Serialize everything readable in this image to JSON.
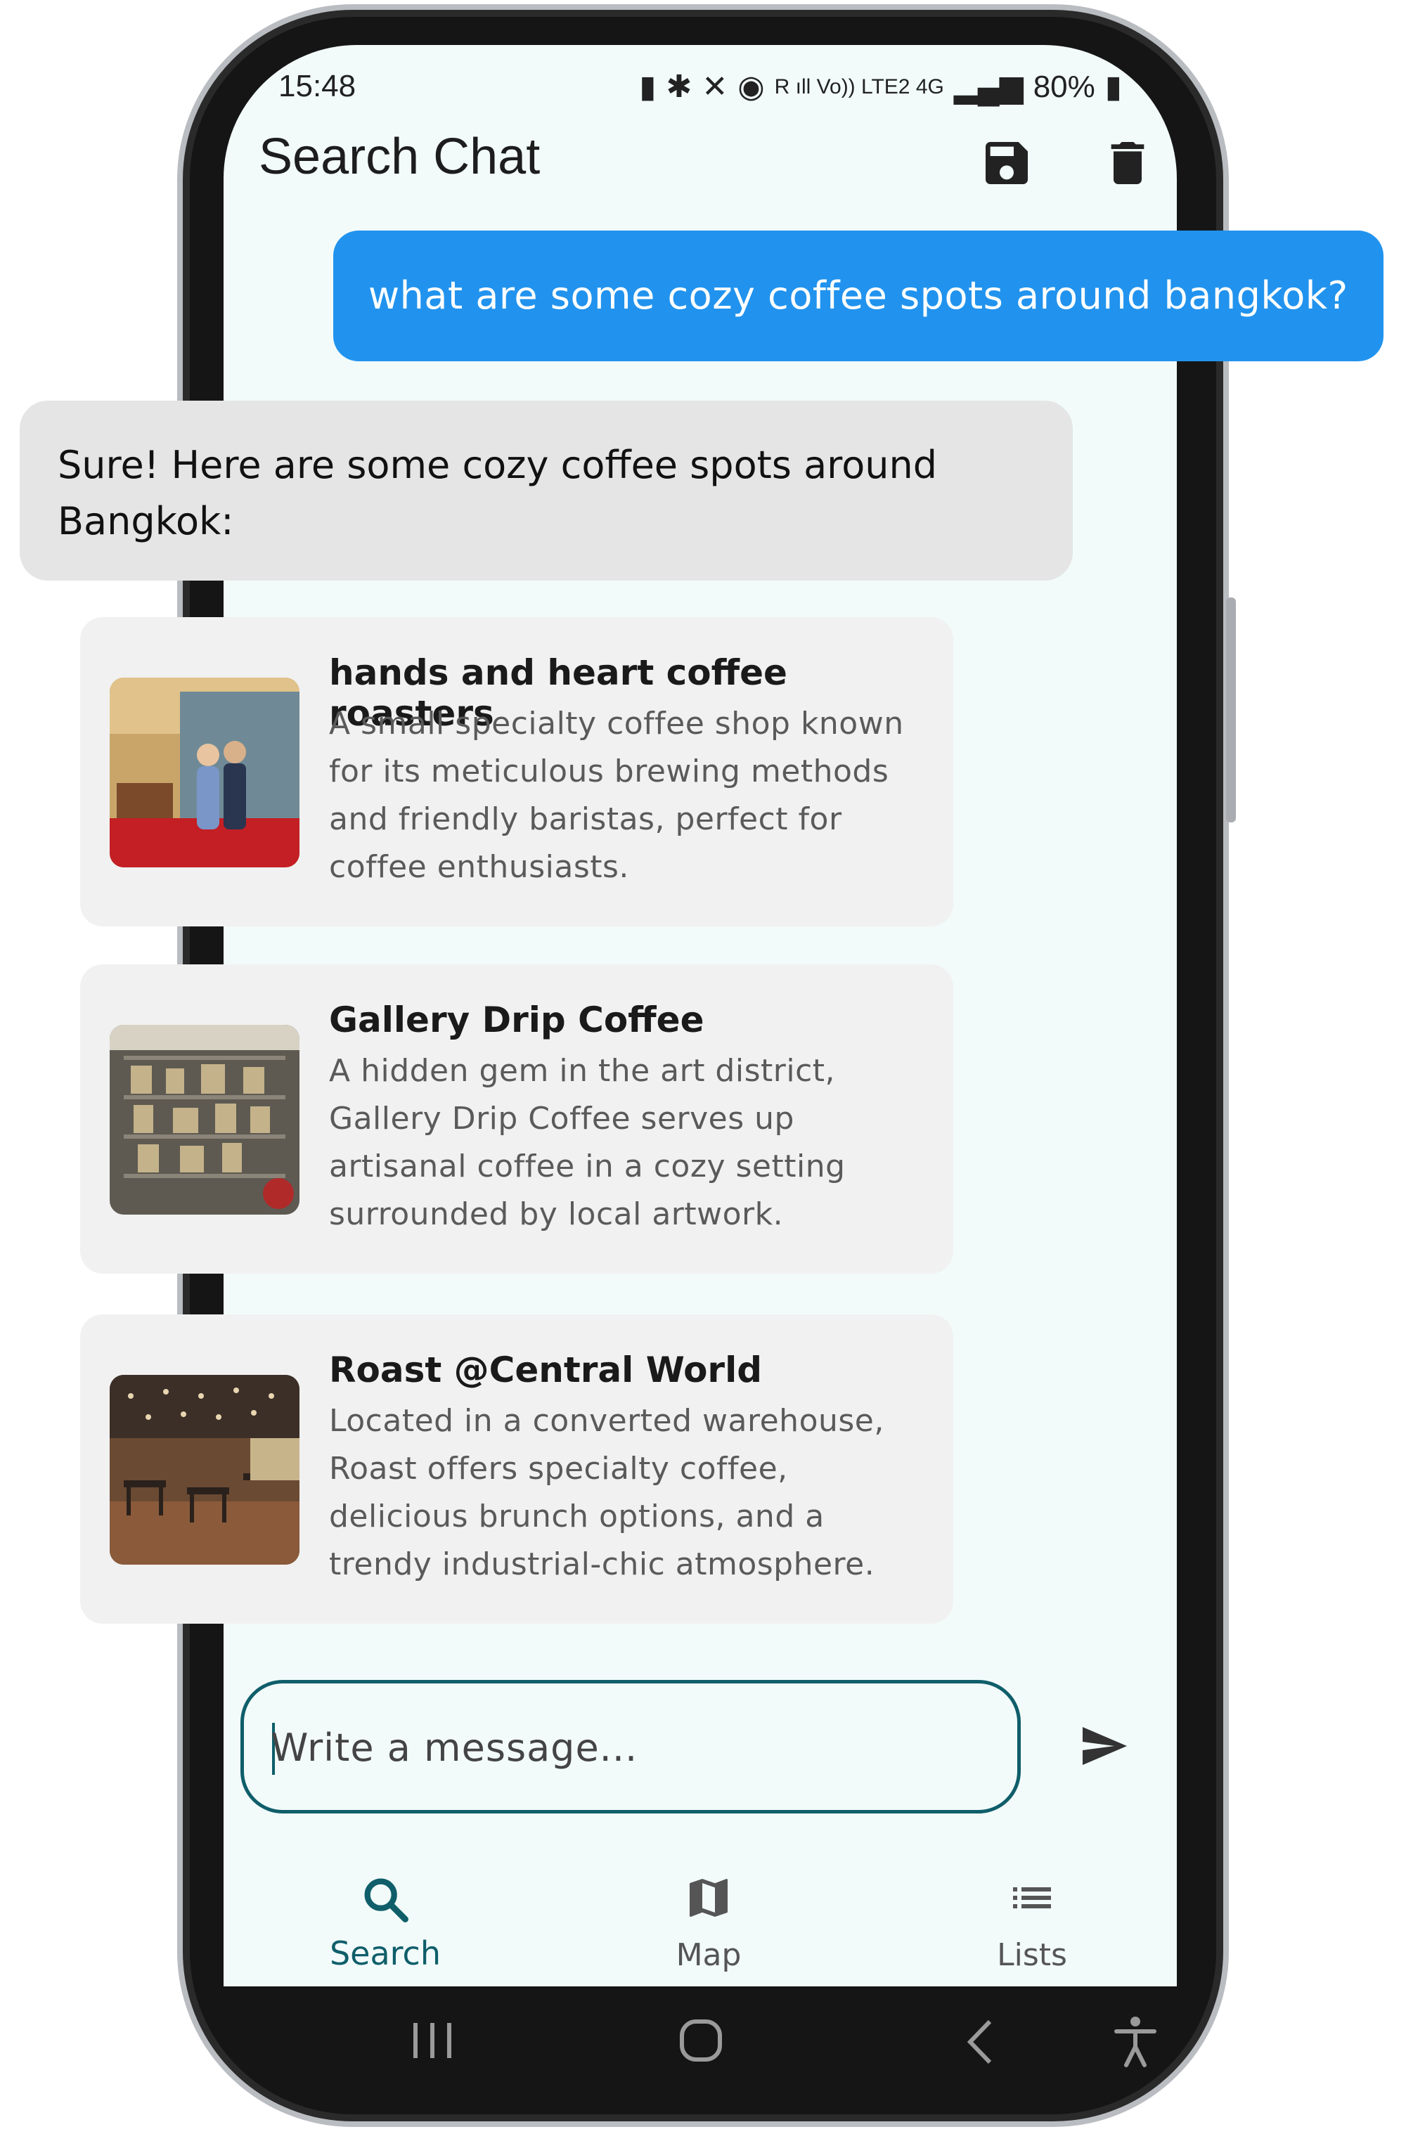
{
  "status_bar": {
    "time": "15:48",
    "network_labels": "R ıll  Vo)) LTE2  4G",
    "battery": "80%"
  },
  "header": {
    "title": "Search Chat",
    "save_icon": "save-icon",
    "delete_icon": "trash-icon"
  },
  "chat": {
    "user_message": "what are some cozy coffee spots around bangkok?",
    "bot_message": "Sure! Here are some cozy coffee spots around Bangkok:",
    "places": [
      {
        "name": "hands and heart coffee roasters",
        "description": "A small specialty coffee shop known for its meticulous brewing methods and friendly baristas, perfect for coffee enthusiasts."
      },
      {
        "name": "Gallery Drip Coffee",
        "description": "A hidden gem in the art district, Gallery Drip Coffee serves up artisanal coffee in a cozy setting surrounded by local artwork."
      },
      {
        "name": "Roast @Central World",
        "description": "Located in a converted warehouse, Roast offers specialty coffee, delicious brunch options, and a trendy industrial-chic atmosphere."
      }
    ]
  },
  "composer": {
    "placeholder": "Write a message..."
  },
  "bottom_nav": {
    "items": [
      {
        "label": "Search",
        "icon": "search-icon",
        "active": true
      },
      {
        "label": "Map",
        "icon": "map-icon",
        "active": false
      },
      {
        "label": "Lists",
        "icon": "list-icon",
        "active": false
      }
    ]
  },
  "colors": {
    "accent": "#0f5e6a",
    "user_bubble": "#2193ee",
    "bot_bubble": "#e5e5e5",
    "card": "#f1f1f1",
    "screen_bg": "#f2fbfa"
  }
}
